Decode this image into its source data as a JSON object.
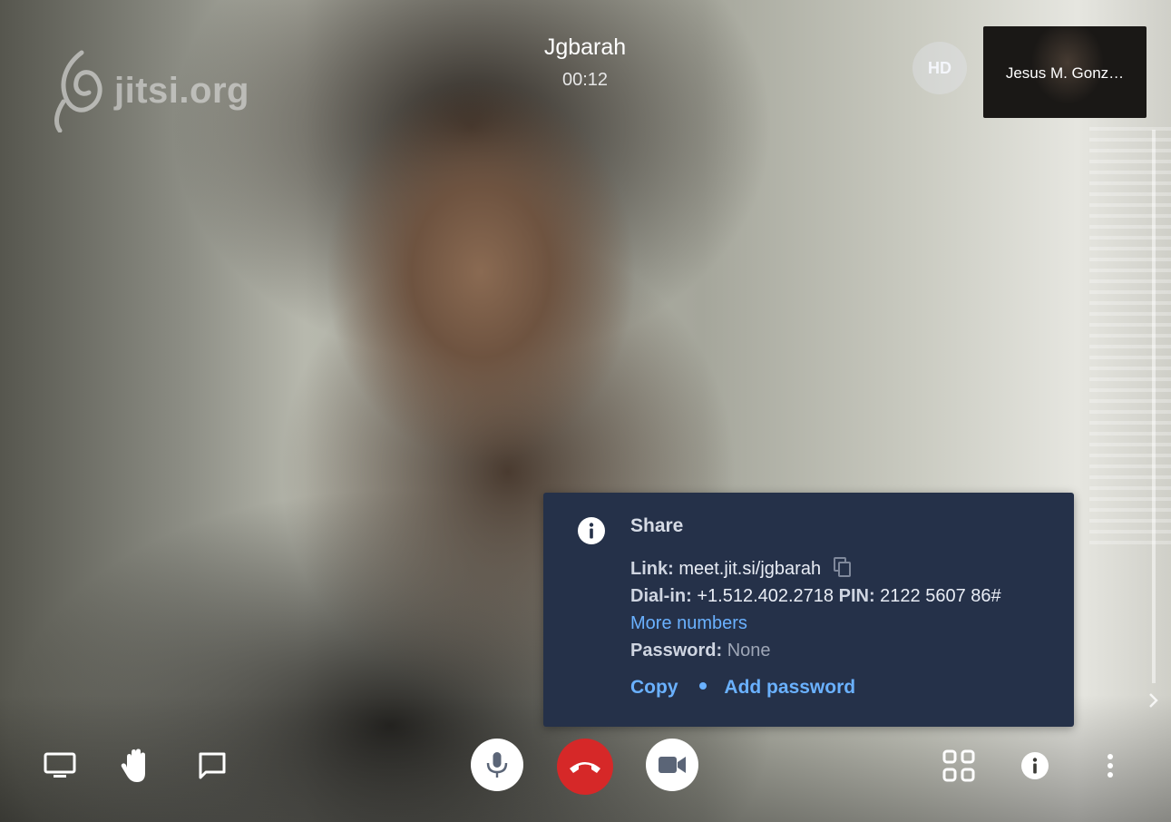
{
  "watermark": {
    "text": "jitsi.org"
  },
  "conference": {
    "name": "Jgbarah",
    "timer": "00:12"
  },
  "quality_badge": "HD",
  "filmstrip": {
    "participant_name": "Jesus M. Gonz…"
  },
  "info_dialog": {
    "title": "Share",
    "link_label": "Link:",
    "link_value": "meet.jit.si/jgbarah",
    "dialin_label": "Dial-in:",
    "dialin_value": "+1.512.402.2718",
    "pin_label": "PIN:",
    "pin_value": "2122 5607 86#",
    "more_numbers": "More numbers",
    "password_label": "Password:",
    "password_value": "None",
    "copy_action": "Copy",
    "add_password_action": "Add password"
  },
  "icons": {
    "screen_share": "desktop-icon",
    "raise_hand": "hand-icon",
    "chat": "chat-icon",
    "microphone": "microphone-icon",
    "hangup": "hangup-icon",
    "camera": "camera-icon",
    "tile_view": "tile-view-icon",
    "info": "info-icon",
    "more": "more-vertical-icon"
  },
  "colors": {
    "dialog_bg": "#253149",
    "link": "#6ab1ff",
    "hangup": "#d62828"
  }
}
